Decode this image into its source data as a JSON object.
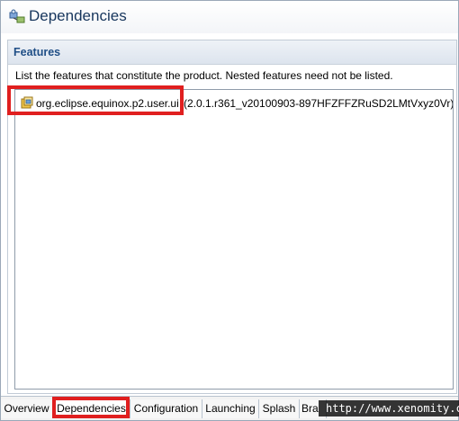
{
  "editor": {
    "title": "Dependencies",
    "icon": "plugin-dependencies-icon"
  },
  "features_section": {
    "title": "Features",
    "description": "List the features that constitute the product.  Nested features need not be listed.",
    "items": [
      {
        "id": "org.eclipse.equinox.p2.user.ui",
        "version": "(2.0.1.r361_v20100903-897HFZFFZRuSD2LMtVxyz0Vr)",
        "icon": "feature-icon"
      }
    ]
  },
  "tabs": [
    {
      "label": "Overview"
    },
    {
      "label": "Dependencies",
      "active": true
    },
    {
      "label": "Configuration"
    },
    {
      "label": "Launching"
    },
    {
      "label": "Splash"
    },
    {
      "label": "Bra"
    }
  ],
  "watermark": "http://www.xenomity.com",
  "colors": {
    "highlight": "#e01f1f",
    "section_title": "#1f4e86",
    "editor_title": "#17365d"
  }
}
